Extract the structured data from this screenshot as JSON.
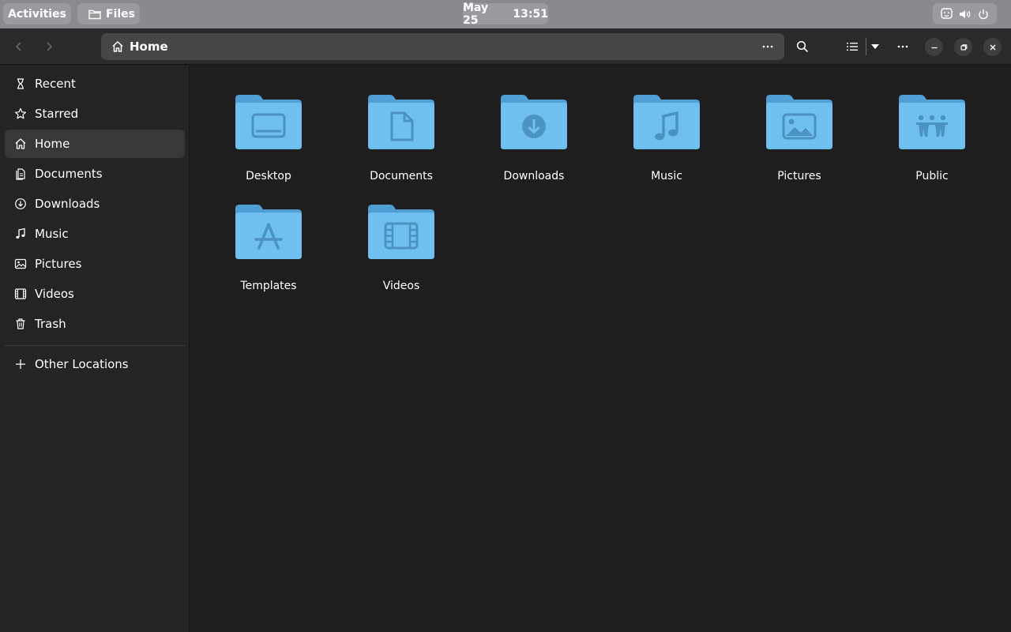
{
  "topbar": {
    "activities": "Activities",
    "app_name": "Files",
    "date": "May 25",
    "time": "13:51"
  },
  "header": {
    "location": "Home"
  },
  "sidebar": {
    "items": [
      {
        "label": "Recent",
        "icon": "recent-icon"
      },
      {
        "label": "Starred",
        "icon": "star-icon"
      },
      {
        "label": "Home",
        "icon": "home-icon",
        "active": true
      },
      {
        "label": "Documents",
        "icon": "documents-icon"
      },
      {
        "label": "Downloads",
        "icon": "downloads-icon"
      },
      {
        "label": "Music",
        "icon": "music-icon"
      },
      {
        "label": "Pictures",
        "icon": "pictures-icon"
      },
      {
        "label": "Videos",
        "icon": "videos-icon"
      },
      {
        "label": "Trash",
        "icon": "trash-icon"
      }
    ],
    "other_locations": "Other Locations"
  },
  "folders": [
    {
      "label": "Desktop",
      "icon": "desktop-folder-icon"
    },
    {
      "label": "Documents",
      "icon": "documents-folder-icon"
    },
    {
      "label": "Downloads",
      "icon": "downloads-folder-icon"
    },
    {
      "label": "Music",
      "icon": "music-folder-icon"
    },
    {
      "label": "Pictures",
      "icon": "pictures-folder-icon"
    },
    {
      "label": "Public",
      "icon": "public-folder-icon"
    },
    {
      "label": "Templates",
      "icon": "templates-folder-icon"
    },
    {
      "label": "Videos",
      "icon": "videos-folder-icon"
    }
  ],
  "colors": {
    "folder_back": "#4f9fd4",
    "folder_front": "#6fc0f0",
    "folder_emblem": "#4a92c2",
    "sidebar_bg": "#242424",
    "main_bg": "#1e1e1e",
    "topbar_bg": "#8a8a8e"
  }
}
